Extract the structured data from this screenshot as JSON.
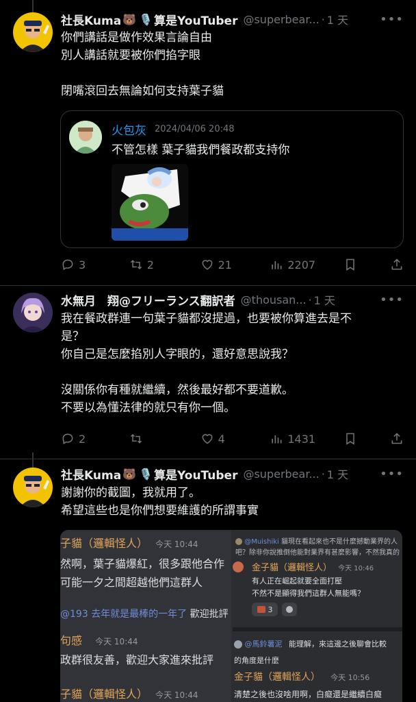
{
  "tweets": [
    {
      "name_a": "社長Kuma",
      "emoji_1": "🐻",
      "emoji_2": "🎙️",
      "name_b": "算是YouTuber",
      "handle": "@superbear...",
      "time": "1 天",
      "lines": [
        "你們講話是做作效果言論自由",
        "別人講話就要被你們掐字眼",
        "",
        "閉嘴滾回去無論如何支持葉子貓"
      ],
      "quote": {
        "name": "火包灰",
        "date": "2024/04/06 20:48",
        "text": "不管怎樣 葉子貓我們餐政都支持你"
      },
      "stats": {
        "replies": "3",
        "retweets": "2",
        "likes": "21",
        "views": "2207"
      }
    },
    {
      "name_a": "水無月　翔@フリーランス翻訳者",
      "handle": "@thousan...",
      "time": "1 天",
      "lines": [
        "我在餐政群連一句葉子貓都沒提過，也要被你算進去是不",
        "是？",
        "你自己是怎麼掐別人字眼的，還好意思說我？",
        "",
        "沒關係你有種就繼續，然後最好都不要道歉。",
        "不要以為懂法律的就只有你一個。"
      ],
      "stats": {
        "replies": "2",
        "retweets": "",
        "likes": "4",
        "views": "1431"
      }
    },
    {
      "name_a": "社長Kuma",
      "emoji_1": "🐻",
      "emoji_2": "🎙️",
      "name_b": "算是YouTuber",
      "handle": "@superbear...",
      "time": "1 天",
      "lines": [
        "謝謝你的截圖，我就用了。",
        "希望這些也是你們想要維護的所謂事實"
      ],
      "screenshot": {
        "left": {
          "r1_name": "子貓（邏輯怪人）",
          "r1_time": "今天 10:44",
          "r1_l1": "然啊，葉子貓爆紅，很多跟他合作",
          "r1_l2": "可能一夕之間超越他們這群人",
          "mention": "@193",
          "mention_text": "去年就是最棒的一年了",
          "mention_tail": "歡迎批評",
          "r2_name": "句感",
          "r2_time": "今天 10:44",
          "r2_l1": "政群很友善，歡迎大家進來批評",
          "r3_name": "子貓（邏輯怪人）",
          "r3_time": "今天 10:44"
        },
        "right": {
          "reply_user": "@Muishiki",
          "reply_text": "貓現在看起來也不是什麼撼動業界的人",
          "reply_text2": "吧？除非你說推倒他能對業界有甚麼影響，不然我真的",
          "n1": "金子貓（邏輯怪人）",
          "t1": "今天 10:46",
          "m1a": "有人正在崛起就要全面打壓",
          "m1b": "不然不是顯得我們這群人無能嗎？",
          "react_count": "3",
          "reply2_user": "@馬鈴薯泥",
          "reply2_text": "能理解，來這邊之後聊會比較",
          "reply2_text2": "的角度是什麼",
          "n2": "金子貓（邏輯怪人）",
          "t2": "今天 10:56",
          "m2": "清楚之後也沒啥用啊，白癡還是繼續白癡"
        }
      }
    }
  ],
  "colors": {
    "link": "#1d9bf0",
    "muted": "#71767b",
    "mention": "#6d8fd8",
    "name_orange": "#e0a458"
  }
}
